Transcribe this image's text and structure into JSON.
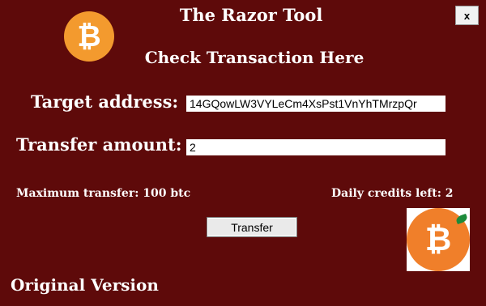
{
  "window": {
    "title": "The Razor Tool",
    "close_label": "x"
  },
  "header": {
    "subtitle": "Check Transaction Here"
  },
  "icons": {
    "logo": "bitcoin-icon",
    "logo_glyph": "₿",
    "badge": "bitcoin-leaf-icon",
    "badge_glyph": "₿",
    "accent": "#f39a2e"
  },
  "form": {
    "target_label": "Target address:",
    "target_value": "14GQowLW3VYLeCm4XsPst1VnYhTMrzpQr",
    "amount_label": "Transfer amount:",
    "amount_value": "2"
  },
  "info": {
    "max_transfer": "Maximum transfer: 100 btc",
    "daily_credits_label": "Daily credits left:  2"
  },
  "actions": {
    "transfer_label": "Transfer"
  },
  "footer": {
    "version": "Original Version"
  }
}
